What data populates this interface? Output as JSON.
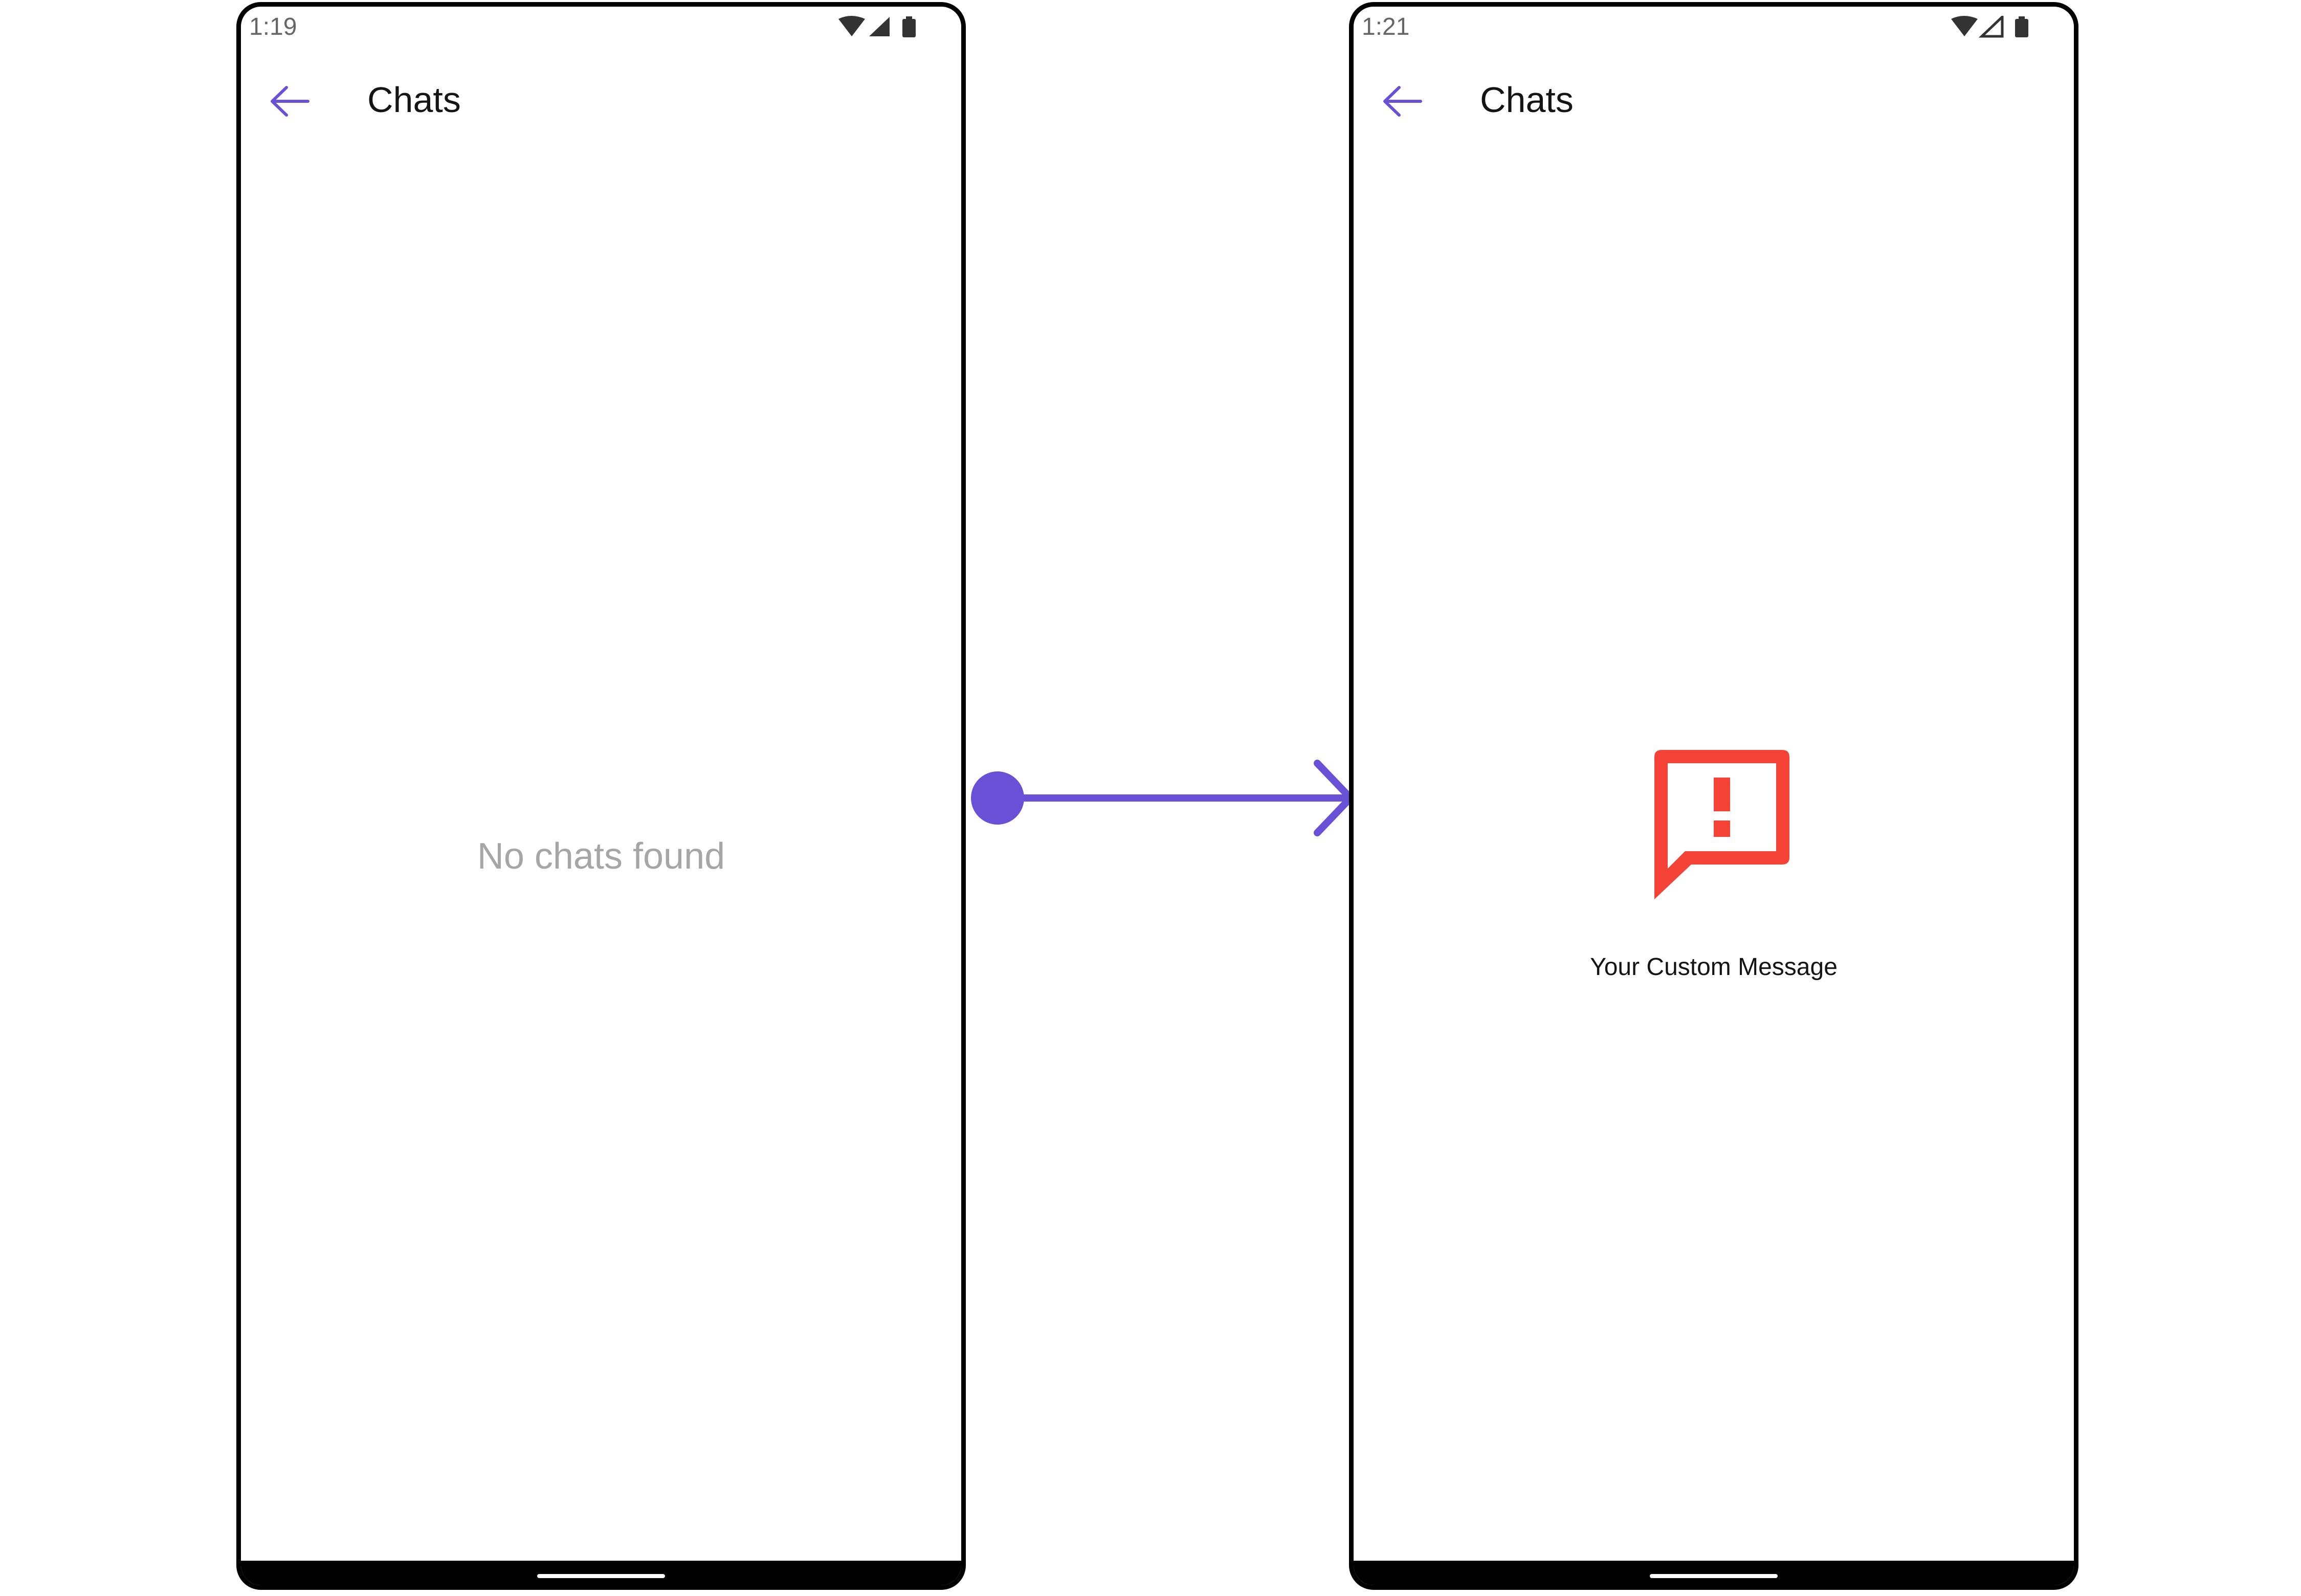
{
  "colors": {
    "accent": "#6851d6",
    "error": "#f44336",
    "title": "#141414",
    "empty_text": "#a6a6a6",
    "frame": "#000000",
    "status_text": "#666666"
  },
  "screens": [
    {
      "status": {
        "time": "1:19",
        "icons": [
          "wifi-icon",
          "cell-signal-icon",
          "battery-icon"
        ]
      },
      "app_bar": {
        "back_icon": "back-arrow-icon",
        "title": "Chats"
      },
      "body": {
        "empty_message": "No chats found"
      }
    },
    {
      "status": {
        "time": "1:21",
        "icons": [
          "wifi-icon",
          "cell-signal-outline-icon",
          "battery-icon"
        ]
      },
      "app_bar": {
        "back_icon": "back-arrow-icon",
        "title": "Chats"
      },
      "body": {
        "state_icon": "error-message-icon",
        "custom_message": "Your Custom Message"
      }
    }
  ],
  "connector": {
    "icon": "transition-arrow-icon"
  }
}
